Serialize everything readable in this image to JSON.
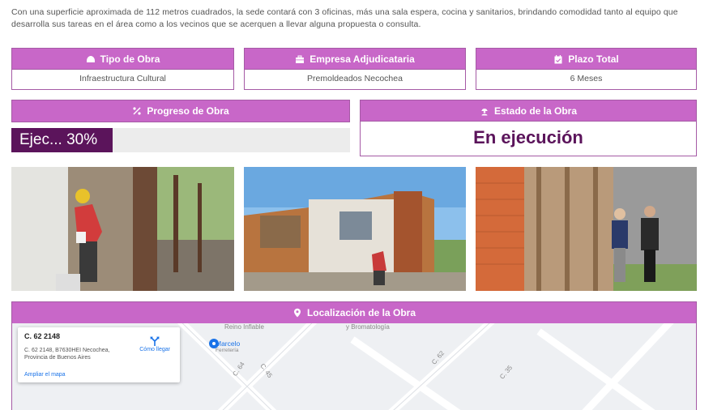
{
  "intro": "Con una superficie aproximada de 112 metros cuadrados, la sede contará con 3 oficinas, más una sala espera, cocina y sanitarios, brindando comodidad tanto al equipo que desarrolla sus tareas en el área como a los vecinos que se acerquen a llevar alguna propuesta o consulta.",
  "info_cards": [
    {
      "title": "Tipo de Obra",
      "icon": "dome-icon",
      "value": "Infraestructura Cultural"
    },
    {
      "title": "Empresa Adjudicataria",
      "icon": "briefcase-icon",
      "value": "Premoldeados Necochea"
    },
    {
      "title": "Plazo Total",
      "icon": "calendar-icon",
      "value": "6 Meses"
    }
  ],
  "progress": {
    "title": "Progreso de Obra",
    "icon": "percent-icon",
    "label": "Ejec... 30%",
    "percent": 30
  },
  "estado": {
    "title": "Estado de la Obra",
    "icon": "worker-icon",
    "value": "En ejecución"
  },
  "location": {
    "title": "Localización de la Obra",
    "icon": "map-pin-icon",
    "map": {
      "place_title": "C. 62 2148",
      "address": "C. 62 2148, B7630HEI Necochea, Provincia de Buenos Aires",
      "directions_label": "Cómo llegar",
      "enlarge_label": "Ampliar el mapa",
      "labels": [
        "Reino Inflable",
        "y Bromatología",
        "Marcelo",
        "Ferretería",
        "C. 64",
        "C. 45",
        "C. 62",
        "C. 35"
      ]
    }
  },
  "colors": {
    "header": "#c867c8",
    "border": "#a55aa5",
    "dark": "#5b145b"
  }
}
